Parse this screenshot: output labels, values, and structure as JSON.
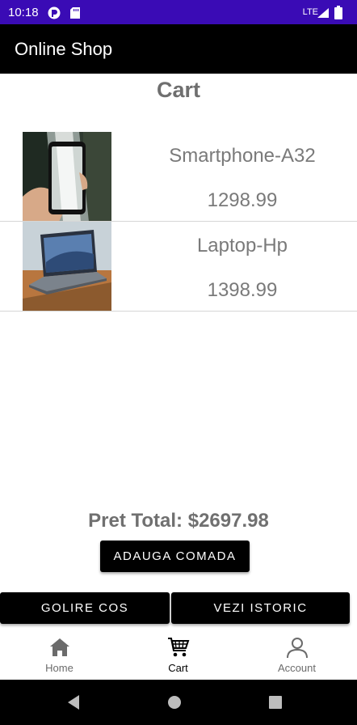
{
  "status_bar": {
    "time": "10:18",
    "network": "LTE",
    "bg_color": "#3a0bb5"
  },
  "app_bar": {
    "title": "Online Shop"
  },
  "page": {
    "title": "Cart"
  },
  "cart_items": [
    {
      "name": "Smartphone-A32",
      "price": "1298.99",
      "image": "phone-waterfall-photo"
    },
    {
      "name": "Laptop-Hp",
      "price": "1398.99",
      "image": "laptop-on-desk-photo"
    }
  ],
  "summary": {
    "total": "Pret Total: $2697.98"
  },
  "buttons": {
    "place_order": "ADAUGA COMADA",
    "empty_cart": "GOLIRE COS",
    "view_history": "VEZI ISTORIC"
  },
  "bottom_nav": [
    {
      "label": "Home",
      "icon": "home-icon",
      "active": false
    },
    {
      "label": "Cart",
      "icon": "cart-icon",
      "active": true
    },
    {
      "label": "Account",
      "icon": "account-icon",
      "active": false
    }
  ]
}
